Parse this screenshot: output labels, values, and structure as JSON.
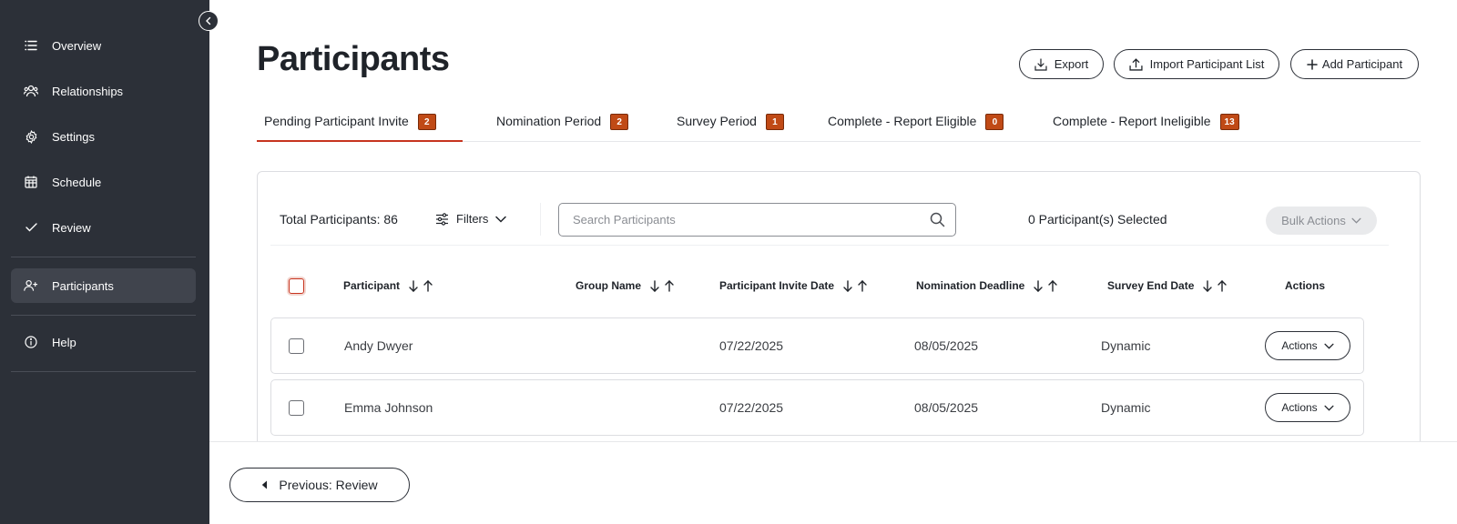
{
  "sidebar": {
    "items": [
      {
        "label": "Overview",
        "icon": "list-icon"
      },
      {
        "label": "Relationships",
        "icon": "people-icon"
      },
      {
        "label": "Settings",
        "icon": "gear-icon"
      },
      {
        "label": "Schedule",
        "icon": "calendar-icon"
      },
      {
        "label": "Review",
        "icon": "check-icon"
      },
      {
        "label": "Participants",
        "icon": "add-person-icon",
        "active": true
      },
      {
        "label": "Help",
        "icon": "info-icon"
      }
    ]
  },
  "header": {
    "title": "Participants",
    "export_label": "Export",
    "import_label": "Import Participant List",
    "add_label": "Add Participant"
  },
  "tabs": [
    {
      "label": "Pending Participant Invite",
      "count": "2",
      "active": true
    },
    {
      "label": "Nomination Period",
      "count": "2"
    },
    {
      "label": "Survey Period",
      "count": "1"
    },
    {
      "label": "Complete - Report Eligible",
      "count": "0"
    },
    {
      "label": "Complete - Report Ineligible",
      "count": "13"
    }
  ],
  "toolbar": {
    "total": "Total Participants: 86",
    "filters_label": "Filters",
    "search_placeholder": "Search Participants",
    "selected_text": "0 Participant(s) Selected",
    "bulk_label": "Bulk Actions"
  },
  "table": {
    "columns": [
      "Participant",
      "Group Name",
      "Participant Invite Date",
      "Nomination Deadline",
      "Survey End Date",
      "Actions"
    ],
    "rows": [
      {
        "participant": "Andy Dwyer",
        "group": "",
        "invite_date": "07/22/2025",
        "nomination_deadline": "08/05/2025",
        "survey_end": "Dynamic",
        "actions_label": "Actions"
      },
      {
        "participant": "Emma Johnson",
        "group": "",
        "invite_date": "07/22/2025",
        "nomination_deadline": "08/05/2025",
        "survey_end": "Dynamic",
        "actions_label": "Actions"
      }
    ]
  },
  "footer": {
    "prev_label": "Previous: Review"
  },
  "colors": {
    "sidebar_bg": "#2c3038",
    "accent": "#c7341f",
    "badge": "#c04a16"
  }
}
